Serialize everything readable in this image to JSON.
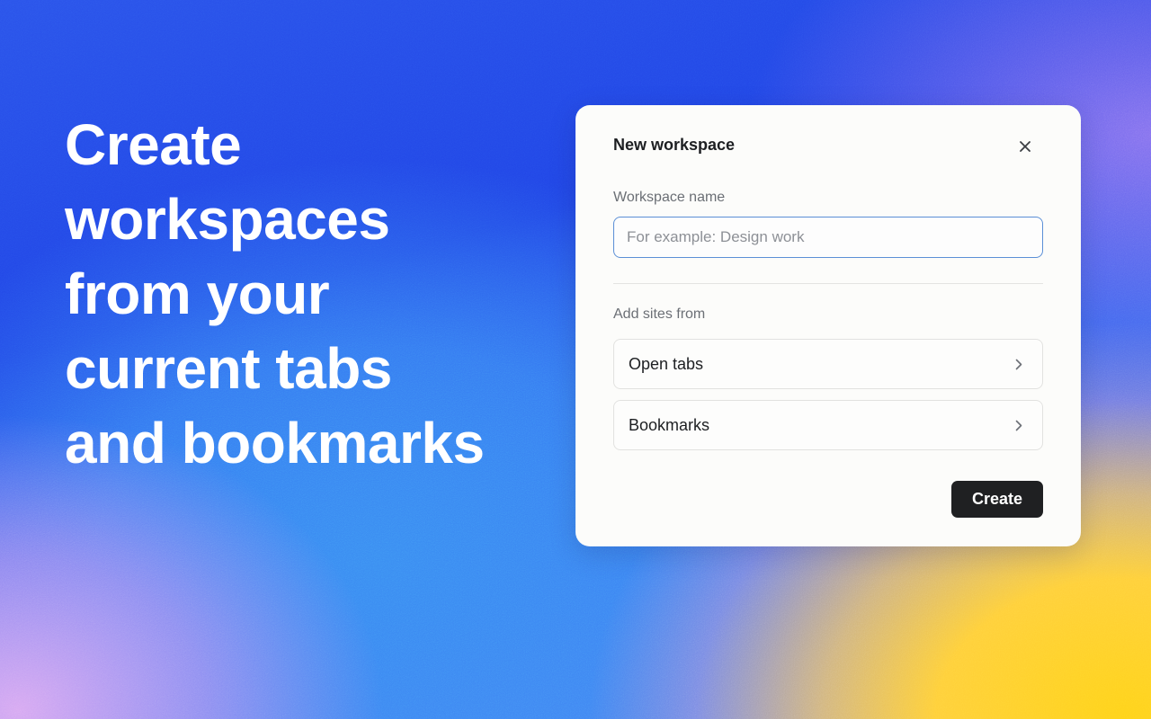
{
  "hero": {
    "headline_lines": [
      "Create",
      "workspaces",
      "from your",
      "current tabs",
      "and bookmarks"
    ]
  },
  "dialog": {
    "title": "New workspace",
    "close_icon": "close-icon",
    "name_field": {
      "label": "Workspace name",
      "placeholder": "For example: Design work",
      "value": ""
    },
    "sources": {
      "label": "Add sites from",
      "items": [
        {
          "label": "Open tabs",
          "icon": "chevron-right-icon"
        },
        {
          "label": "Bookmarks",
          "icon": "chevron-right-icon"
        }
      ]
    },
    "create_label": "Create"
  },
  "colors": {
    "primary_button": "#1f2022",
    "input_focus_border": "#5b8fd6",
    "background_blue": "#2044e6",
    "background_yellow": "#ffd21a"
  }
}
